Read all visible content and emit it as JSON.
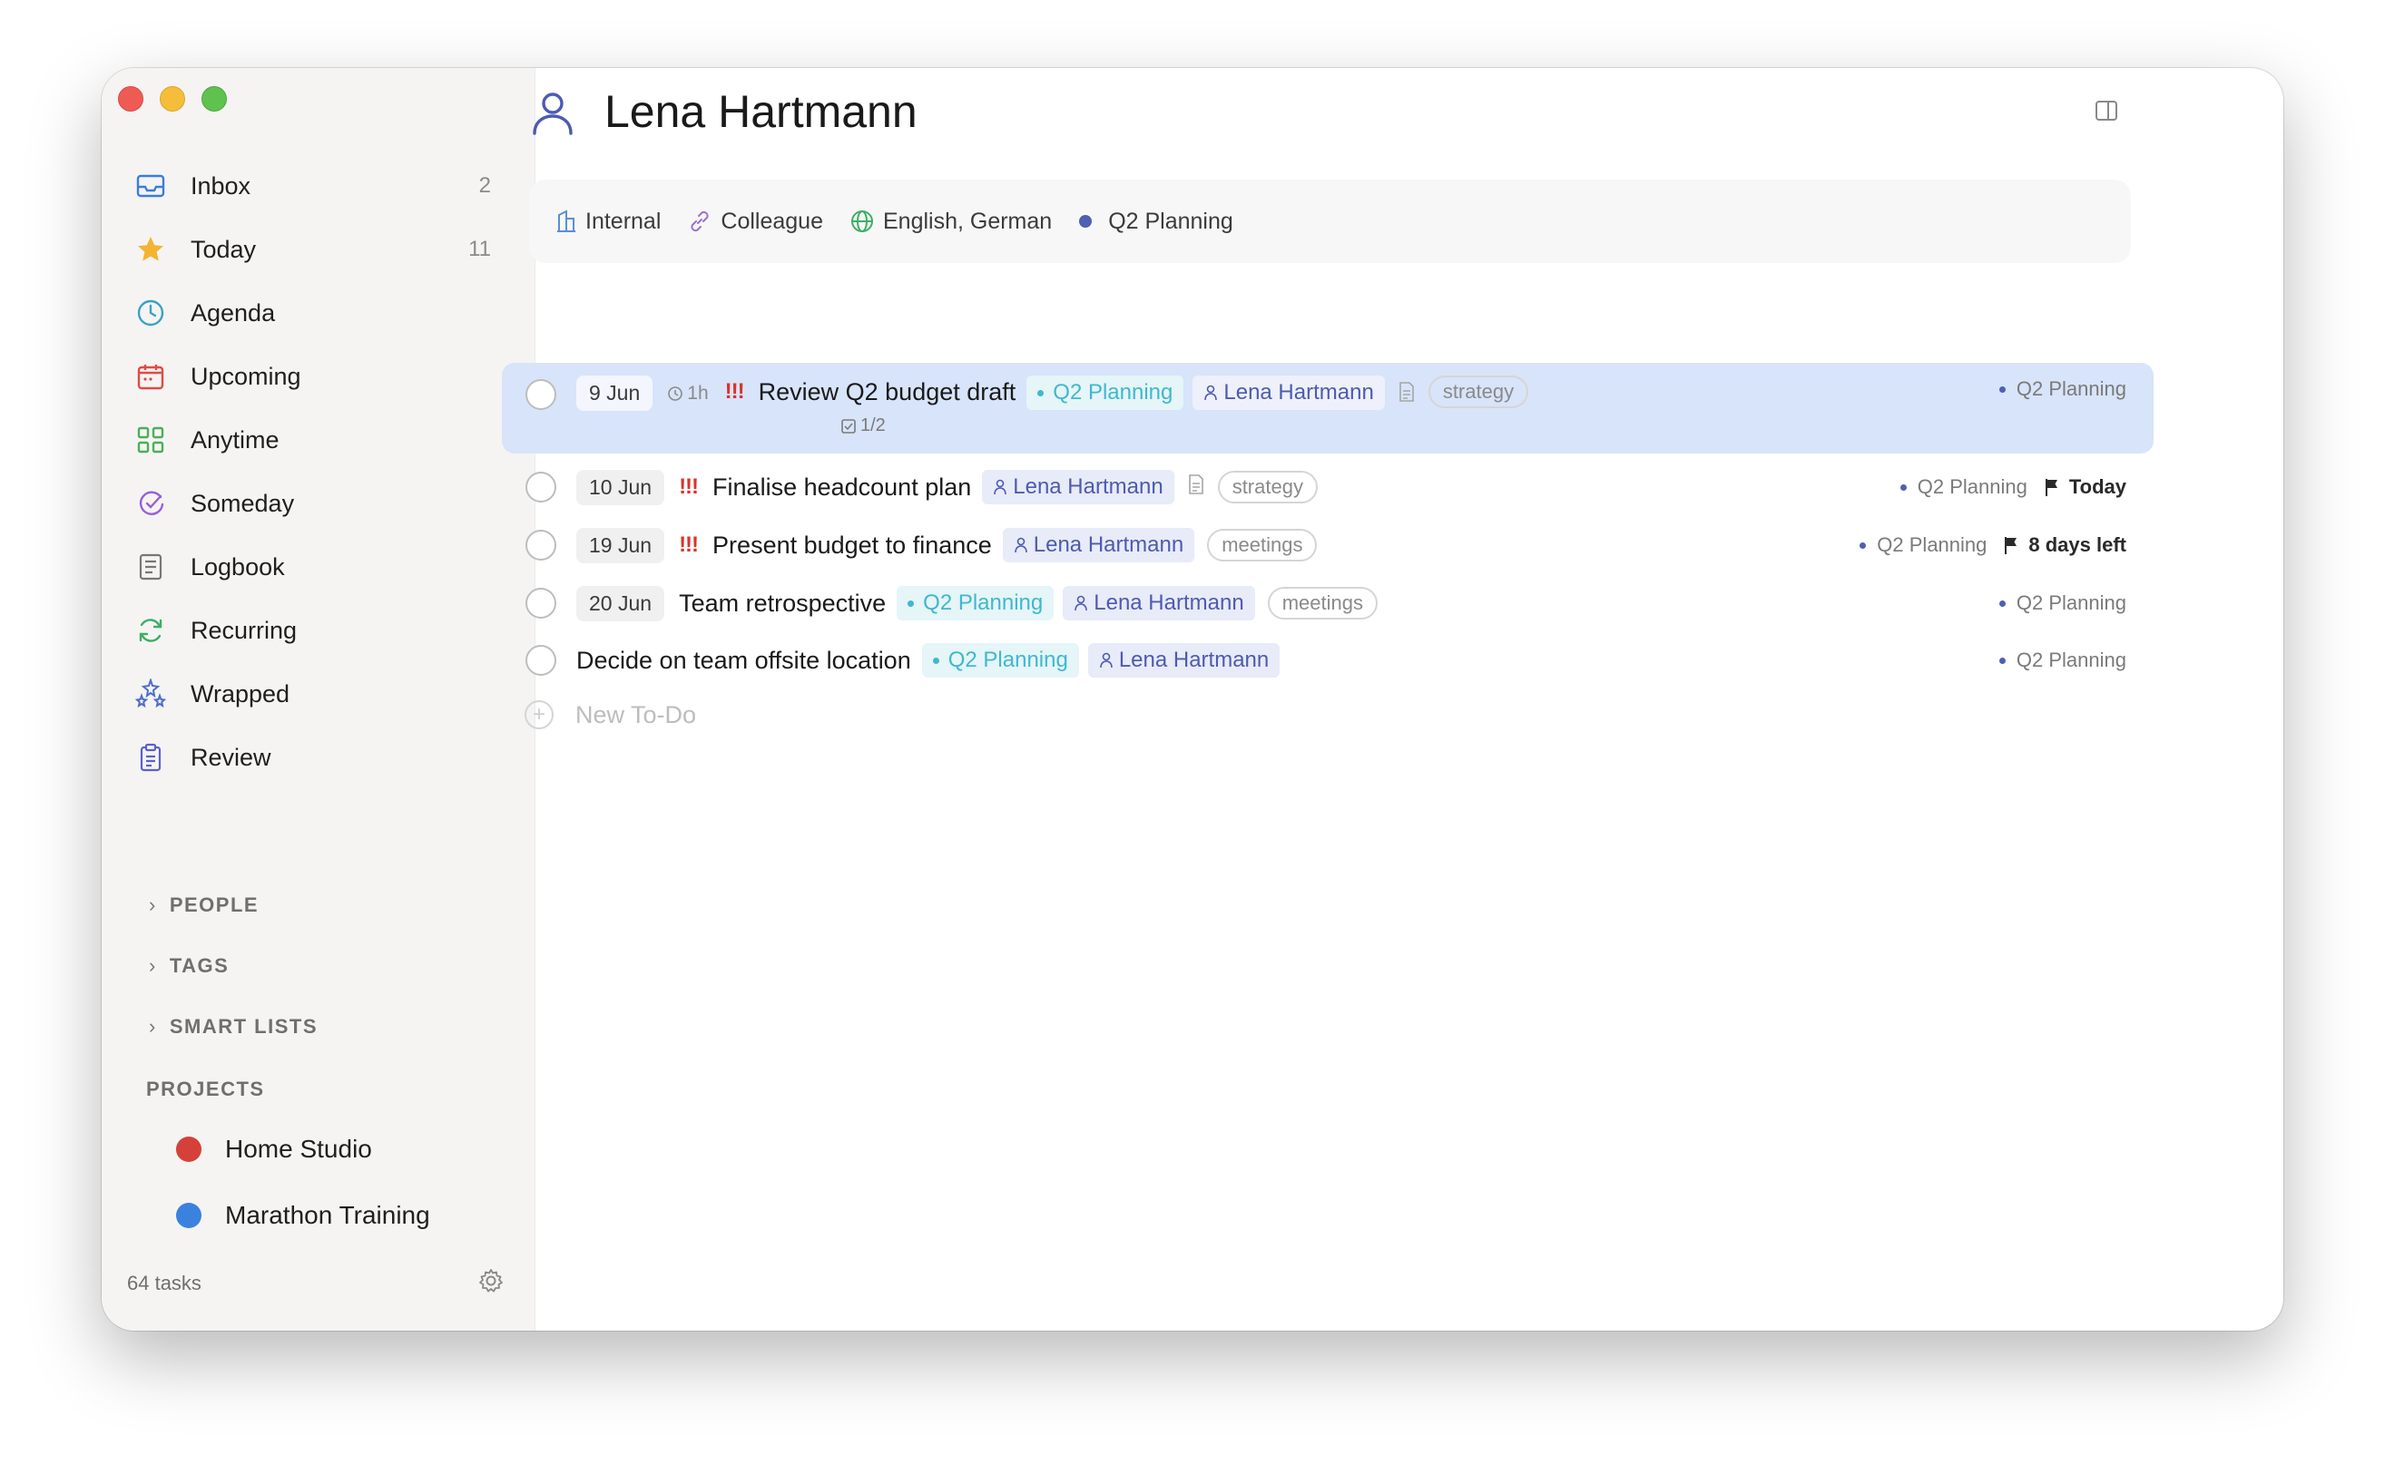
{
  "sidebar": {
    "items": [
      {
        "label": "Inbox",
        "count": "2",
        "icon": "inbox-icon"
      },
      {
        "label": "Today",
        "count": "11",
        "icon": "star-icon"
      },
      {
        "label": "Agenda",
        "count": "",
        "icon": "clock-icon"
      },
      {
        "label": "Upcoming",
        "count": "",
        "icon": "calendar-icon"
      },
      {
        "label": "Anytime",
        "count": "",
        "icon": "grid-icon"
      },
      {
        "label": "Someday",
        "count": "",
        "icon": "someday-icon"
      },
      {
        "label": "Logbook",
        "count": "",
        "icon": "logbook-icon"
      },
      {
        "label": "Recurring",
        "count": "",
        "icon": "recurring-icon"
      },
      {
        "label": "Wrapped",
        "count": "",
        "icon": "sparkle-icon"
      },
      {
        "label": "Review",
        "count": "",
        "icon": "clipboard-icon"
      }
    ],
    "sections": [
      "PEOPLE",
      "TAGS",
      "SMART LISTS"
    ],
    "projects_title": "PROJECTS",
    "projects": [
      {
        "name": "Home Studio",
        "color": "#d6403a"
      },
      {
        "name": "Marathon Training",
        "color": "#3b82df"
      }
    ],
    "footer_count": "64 tasks"
  },
  "header": {
    "title": "Lena Hartmann",
    "meta": {
      "org": "Internal",
      "relation": "Colleague",
      "languages": "English, German",
      "project": "Q2 Planning"
    }
  },
  "tasks": [
    {
      "date": "9 Jun",
      "duration": "1h",
      "priority": "!!!",
      "title": "Review Q2 budget draft",
      "project_chip": "Q2 Planning",
      "person": "Lena Hartmann",
      "tag": "strategy",
      "checklist": "1/2",
      "right_project": "Q2 Planning",
      "deadline": ""
    },
    {
      "date": "10 Jun",
      "priority": "!!!",
      "title": "Finalise headcount plan",
      "person": "Lena Hartmann",
      "tag": "strategy",
      "right_project": "Q2 Planning",
      "deadline": "Today"
    },
    {
      "date": "19 Jun",
      "priority": "!!!",
      "title": "Present budget to finance",
      "person": "Lena Hartmann",
      "tag": "meetings",
      "right_project": "Q2 Planning",
      "deadline": "8 days left"
    },
    {
      "date": "20 Jun",
      "title": "Team retrospective",
      "project_chip": "Q2 Planning",
      "person": "Lena Hartmann",
      "tag": "meetings",
      "right_project": "Q2 Planning"
    },
    {
      "title": "Decide on team offsite location",
      "project_chip": "Q2 Planning",
      "person": "Lena Hartmann",
      "right_project": "Q2 Planning"
    }
  ],
  "new_todo_placeholder": "New To-Do",
  "colors": {
    "selection": "#d8e4f9",
    "priority": "#d9342b",
    "project_teal": "#3fb8cf",
    "person_indigo": "#4d5bb0"
  }
}
